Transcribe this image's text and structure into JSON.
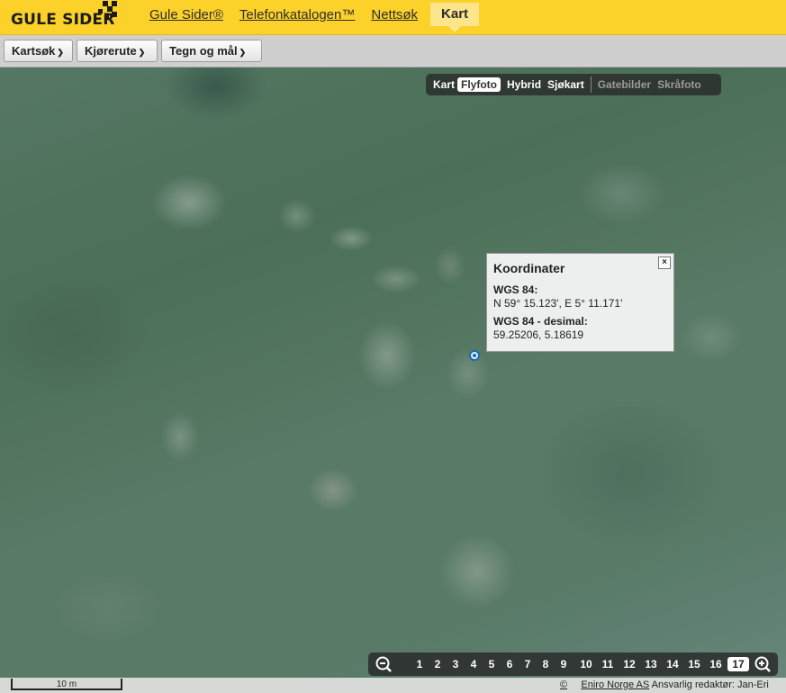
{
  "header": {
    "logo_text": "GULE SIDER",
    "nav": [
      {
        "label": "Gule Sider®"
      },
      {
        "label": "Telefonkatalogen™"
      },
      {
        "label": "Nettsøk"
      },
      {
        "label": "Kart"
      }
    ],
    "active_nav": "Kart",
    "colors": {
      "brand_yellow": "#fcd12a",
      "active_tab": "#fde58b"
    }
  },
  "toolbar": {
    "buttons": [
      {
        "label": "Kartsøk"
      },
      {
        "label": "Kjørerute"
      },
      {
        "label": "Tegn og mål"
      }
    ]
  },
  "map_types": {
    "items": [
      "Kart",
      "Flyfoto",
      "Hybrid",
      "Sjøkart",
      "Gatebilder",
      "Skråfoto"
    ],
    "selected": "Flyfoto"
  },
  "popup": {
    "title": "Koordinater",
    "wgs84_label": "WGS 84:",
    "wgs84_value": "N 59° 15.123', E 5° 11.171'",
    "decimal_label": "WGS 84 - desimal:",
    "decimal_value": "59.25206, 5.18619",
    "close_symbol": "×"
  },
  "zoom": {
    "levels": [
      "1",
      "2",
      "3",
      "4",
      "5",
      "6",
      "7",
      "8",
      "9",
      "10",
      "11",
      "12",
      "13",
      "14",
      "15",
      "16",
      "17"
    ],
    "current": "17"
  },
  "statusbar": {
    "scale_label": "10 m",
    "copyright_symbol": "©",
    "company": "Eniro Norge AS",
    "editor_text": "Ansvarlig redaktør: Jan-Eri"
  }
}
